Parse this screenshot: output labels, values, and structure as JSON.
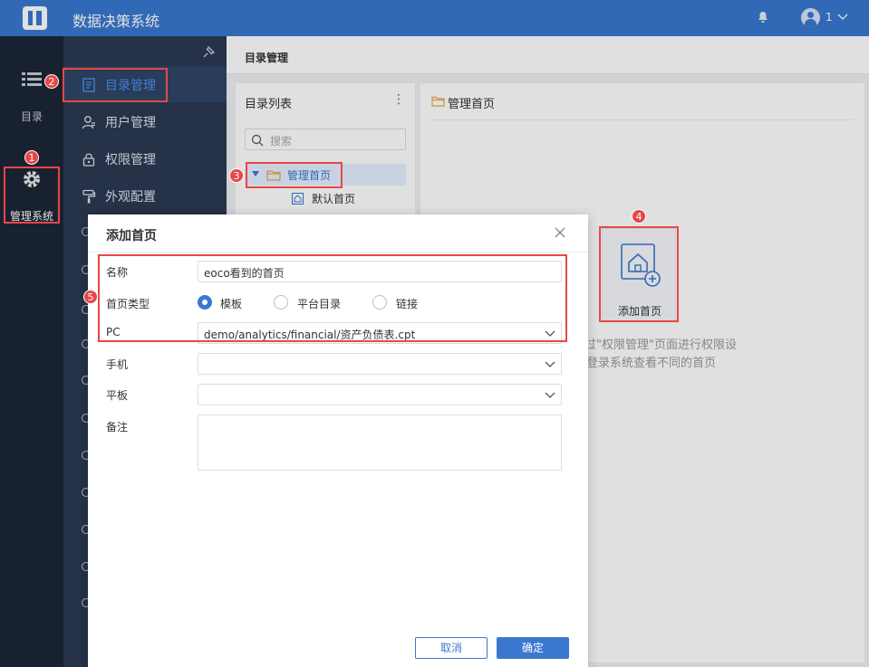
{
  "topbar": {
    "title": "数据决策系统",
    "user": "1"
  },
  "leftbar": {
    "catalog_label": "目录",
    "system_label": "管理系统"
  },
  "menu": {
    "items": [
      {
        "label": "目录管理"
      },
      {
        "label": "用户管理"
      },
      {
        "label": "权限管理"
      },
      {
        "label": "外观配置"
      }
    ]
  },
  "breadcrumb": "目录管理",
  "tree": {
    "header": "目录列表",
    "more": "⋮",
    "search_placeholder": "搜索",
    "selected": "管理首页",
    "child": "默认首页"
  },
  "detail": {
    "header": "管理首页",
    "add_card_label": "添加首页",
    "hint_line1": "可通过\"权限管理\"页面进行权限设",
    "hint_line2": "户登录系统查看不同的首页"
  },
  "dialog": {
    "title": "添加首页",
    "name_label": "名称",
    "name_value": "eoco看到的首页",
    "type_label": "首页类型",
    "type_options": [
      "模板",
      "平台目录",
      "链接"
    ],
    "type_selected": "模板",
    "pc_label": "PC",
    "pc_value": "demo/analytics/financial/资产负债表.cpt",
    "mobile_label": "手机",
    "mobile_value": "",
    "tablet_label": "平板",
    "tablet_value": "",
    "remark_label": "备注",
    "cancel": "取消",
    "ok": "确定"
  },
  "annotations": [
    "1",
    "2",
    "3",
    "4",
    "5"
  ],
  "colors": {
    "brand": "#3a78d0",
    "sidebar": "#1c2636",
    "menu": "#2b3a52",
    "annotation": "#e74747"
  }
}
